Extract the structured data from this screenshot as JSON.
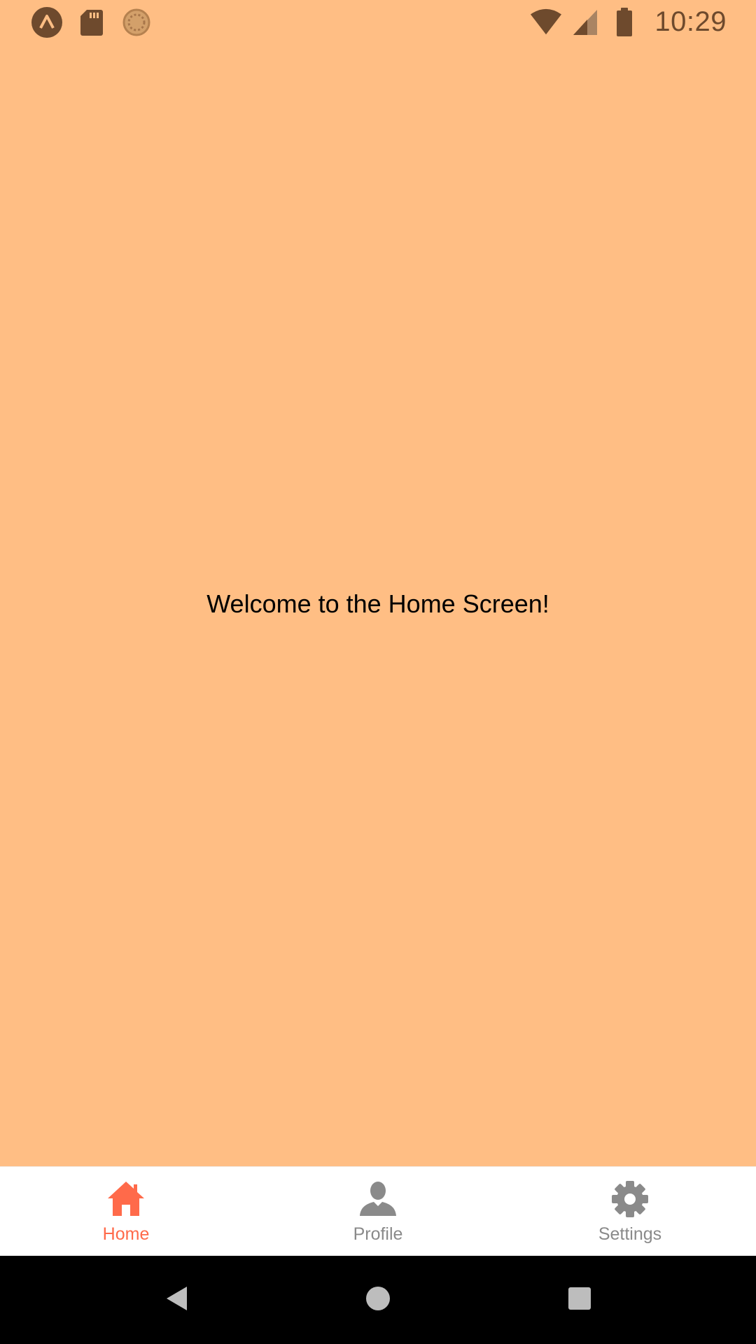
{
  "status_bar": {
    "time": "10:29",
    "left_icons": [
      "expo-icon",
      "sd-card-icon",
      "sync-icon"
    ],
    "right_icons": [
      "wifi-icon",
      "signal-icon",
      "battery-icon"
    ],
    "icon_color": "#6e4a2d"
  },
  "content": {
    "welcome_text": "Welcome to the Home Screen!",
    "background_color": "#ffbe84"
  },
  "tab_bar": {
    "active_color": "#ff6a4a",
    "inactive_color": "#8a8a8a",
    "tabs": [
      {
        "label": "Home",
        "icon": "home-icon",
        "active": true
      },
      {
        "label": "Profile",
        "icon": "person-icon",
        "active": false
      },
      {
        "label": "Settings",
        "icon": "gear-icon",
        "active": false
      }
    ]
  },
  "nav_bar": {
    "buttons": [
      "back-icon",
      "home-circle-icon",
      "recents-icon"
    ]
  }
}
